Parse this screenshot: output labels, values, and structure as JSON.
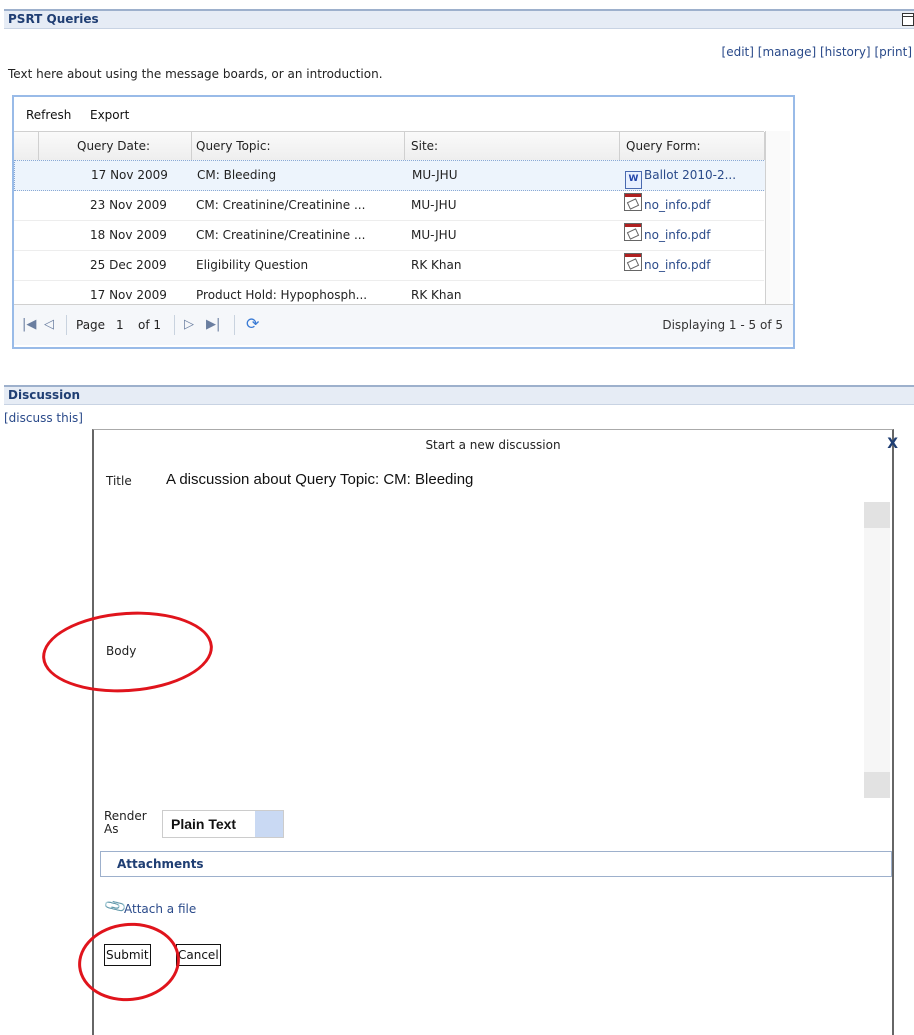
{
  "top_section": {
    "title": "PSRT Queries",
    "actions": [
      "[edit]",
      "[manage]",
      "[history]",
      "[print]"
    ],
    "intro": "Text here about using the message boards, or an introduction."
  },
  "grid": {
    "toolbar": {
      "refresh": "Refresh",
      "export": "Export"
    },
    "columns": [
      "Query Date:",
      "Query Topic:",
      "Site:",
      "Query Form:"
    ],
    "rows": [
      {
        "date": "17 Nov 2009",
        "topic": "CM: Bleeding",
        "site": "MU-JHU",
        "form": "Ballot 2010-2...",
        "form_icon": "word-doc-icon",
        "selected": true
      },
      {
        "date": "23 Nov 2009",
        "topic": "CM: Creatinine/Creatinine ...",
        "site": "MU-JHU",
        "form": "no_info.pdf",
        "form_icon": "pdf-icon"
      },
      {
        "date": "18 Nov 2009",
        "topic": "CM: Creatinine/Creatinine ...",
        "site": "MU-JHU",
        "form": "no_info.pdf",
        "form_icon": "pdf-icon"
      },
      {
        "date": "25 Dec 2009",
        "topic": "Eligibility Question",
        "site": "RK Khan",
        "form": "no_info.pdf",
        "form_icon": "pdf-icon"
      },
      {
        "date": "17 Nov 2009",
        "topic": "Product Hold: Hypophosph...",
        "site": "RK Khan",
        "form": "",
        "form_icon": ""
      }
    ],
    "pager": {
      "page_label": "Page",
      "page_value": "1",
      "of_label": "of 1",
      "display": "Displaying 1 - 5 of 5"
    }
  },
  "discussion": {
    "header": "Discussion",
    "discuss_link": "[discuss this]",
    "form": {
      "title": "Start a new discussion",
      "close": "X",
      "title_label": "Title",
      "title_value": "A discussion about Query Topic: CM: Bleeding",
      "body_label": "Body",
      "render_label_1": "Render",
      "render_label_2": "As",
      "render_value": "Plain Text",
      "attachments_header": "Attachments",
      "attach_link": "Attach a file",
      "submit": "Submit",
      "cancel": "Cancel"
    }
  },
  "colors": {
    "header_bg": "#e6ecf5",
    "header_text": "#1f3e73",
    "grid_border": "#99bbe8",
    "link": "#2a4a8a",
    "annotation_circle": "#e0141c"
  }
}
